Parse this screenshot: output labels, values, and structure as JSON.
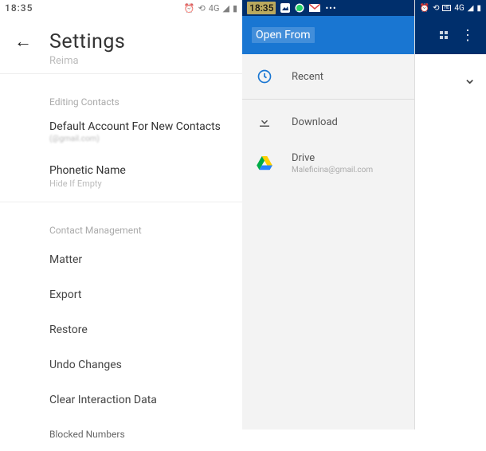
{
  "left": {
    "status": {
      "time": "18:35",
      "net": "4G"
    },
    "title": "Settings",
    "faded_top": "Reima",
    "editing_label": "Editing Contacts",
    "default_account": {
      "title": "Default Account For New Contacts",
      "sub": "(@gmail.com)"
    },
    "phonetic": {
      "title": "Phonetic Name",
      "sub": "Hide If Empty"
    },
    "mgmt_label": "Contact Management",
    "mgmt": [
      "Matter",
      "Export",
      "Restore",
      "Undo Changes",
      "Clear Interaction Data",
      "Blocked Numbers"
    ]
  },
  "right": {
    "status": {
      "time": "18:35",
      "net": "4G"
    },
    "open_title": "Open From",
    "recent": "Recent",
    "download": "Download",
    "drive": {
      "title": "Drive",
      "sub": "Maleficina@gmail.com"
    }
  }
}
